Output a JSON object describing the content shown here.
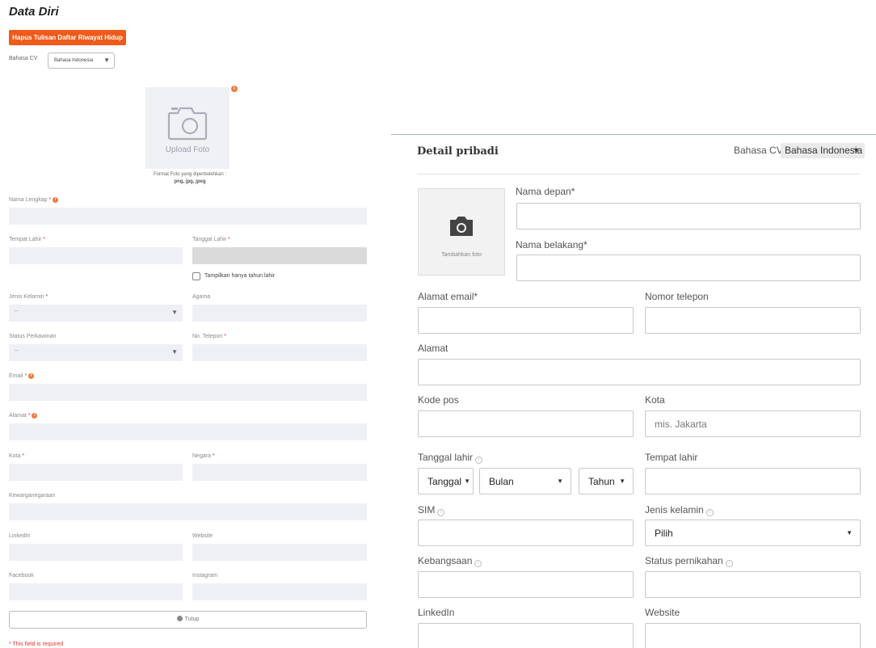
{
  "left": {
    "title": "Data Diri",
    "clear_button": "Hapus Tulisan Daftar Riwayat Hidup",
    "lang_label": "Bahasa CV",
    "lang_value": "Bahasa Indonesia",
    "photo_label": "Upload Foto",
    "photo_info": "i",
    "format_text": "Format Foto yang diperbolehkan :",
    "format_types": "png, jpg, jpeg",
    "fields": {
      "nama_lengkap": "Nama Lengkap",
      "tempat_lahir": "Tempat Lahir",
      "tanggal_lahir": "Tanggal Lahir",
      "only_year": "Tampilkan hanya tahun lahir",
      "jenis_kelamin": "Jenis Kelamin",
      "agama": "Agama",
      "status_perkawinan": "Status Perkawinan",
      "no_telepon": "No. Telepon",
      "email": "Email",
      "alamat": "Alamat",
      "kota": "Kota",
      "negara": "Negara",
      "kewarganegaraan": "Kewarganegaraan",
      "linkedin": "LinkedIn",
      "website": "Website",
      "facebook": "Facebook",
      "instagram": "Instagram"
    },
    "select_placeholder": "--",
    "required_mark": "*",
    "close_button": "Tutup",
    "required_note": "* This field is required"
  },
  "right": {
    "title": "Detail pribadi",
    "lang_label": "Bahasa CV",
    "lang_value": "Bahasa Indonesia",
    "photo_label": "Tambahkan foto",
    "fields": {
      "nama_depan": "Nama depan*",
      "nama_belakang": "Nama belakang*",
      "alamat_email": "Alamat email*",
      "nomor_telepon": "Nomor telepon",
      "alamat": "Alamat",
      "kode_pos": "Kode pos",
      "kota": "Kota",
      "tanggal_lahir": "Tanggal lahir",
      "tempat_lahir": "Tempat lahir",
      "sim": "SIM",
      "jenis_kelamin": "Jenis kelamin",
      "kebangsaan": "Kebangsaan",
      "status_pernikahan": "Status pernikahan",
      "linkedin": "LinkedIn",
      "website": "Website"
    },
    "kota_placeholder": "mis. Jakarta",
    "date_day": "Tanggal",
    "date_month": "Bulan",
    "date_year": "Tahun",
    "gender_value": "Pilih",
    "help_icon": "i"
  },
  "icons": {
    "camera": "camera-icon",
    "chevron": "chevron-down-icon",
    "info": "info-icon"
  },
  "colors": {
    "accent": "#f05a1a",
    "required": "#e3342f",
    "field_bg": "#eef0f5"
  }
}
